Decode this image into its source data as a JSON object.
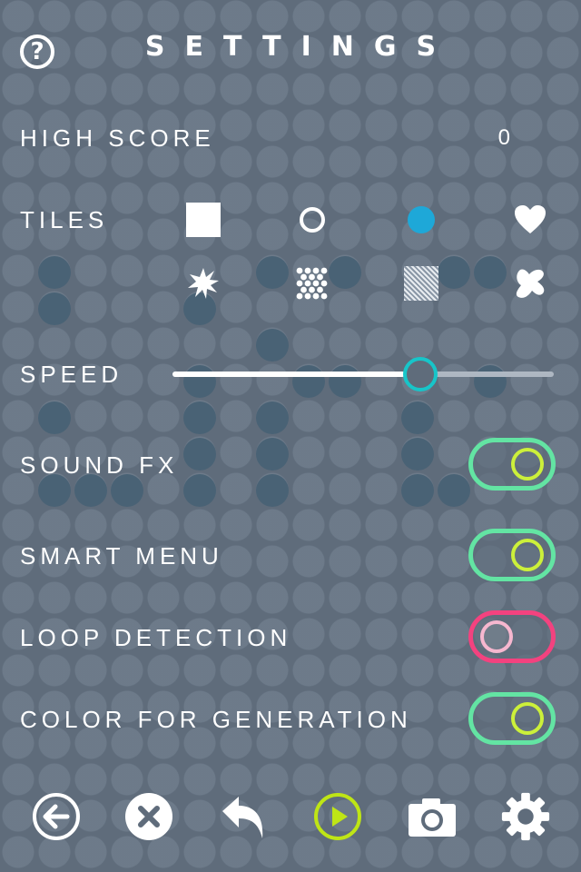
{
  "header": {
    "title": "SETTINGS",
    "help_glyph": "?"
  },
  "rows": {
    "high_score": {
      "label": "HIGH SCORE",
      "value": "0"
    },
    "tiles": {
      "label": "TILES",
      "options": [
        "square",
        "ring",
        "dot",
        "heart",
        "burst",
        "checker",
        "hatched",
        "blob"
      ],
      "selected": "dot"
    },
    "speed": {
      "label": "SPEED",
      "value": 0.65
    },
    "sound_fx": {
      "label": "SOUND FX",
      "on": true
    },
    "smart_menu": {
      "label": "SMART MENU",
      "on": true
    },
    "loop_detection": {
      "label": "LOOP DETECTION",
      "on": false
    },
    "color_for_generation": {
      "label": "COLOR FOR GENERATION",
      "on": true
    }
  },
  "toolbar": {
    "buttons": [
      "back-icon",
      "clear-icon",
      "undo-icon",
      "play-icon",
      "camera-icon",
      "gear-icon"
    ]
  },
  "colors": {
    "background": "#5f6c7b",
    "toggle_on": "#63e4a3",
    "toggle_on_knob": "#ccf03a",
    "toggle_off": "#f3427f",
    "toggle_off_knob": "#f6b7cf",
    "slider_thumb": "#17c5c9",
    "selected_tile": "#1ea8d8",
    "play_accent": "#bfe515"
  }
}
